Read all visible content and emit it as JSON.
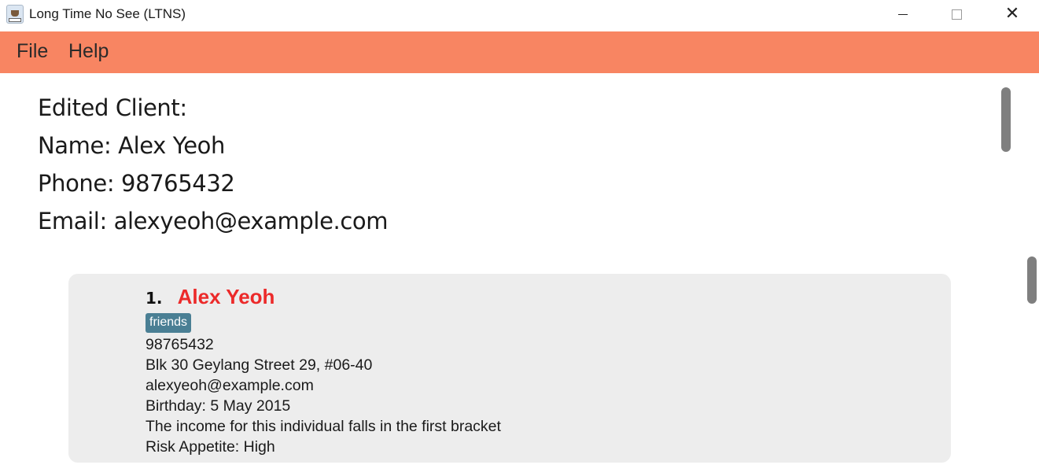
{
  "window": {
    "title": "Long Time No See (LTNS)",
    "icon": "app-icon",
    "controls": [
      "minimize",
      "maximize",
      "close"
    ]
  },
  "menu": {
    "items": [
      {
        "label": "File"
      },
      {
        "label": "Help"
      }
    ],
    "color": "#f88562"
  },
  "result": {
    "heading": "Edited Client:",
    "name_line": "Name: Alex Yeoh",
    "phone_line": "Phone: 98765432",
    "email_line": "Email: alexyeoh@example.com"
  },
  "client_card": {
    "index": "1.",
    "name": "Alex Yeoh",
    "name_color": "#ec2a2a",
    "tags": [
      "friends"
    ],
    "tag_color": "#4a7f94",
    "phone": "98765432",
    "address": "Blk 30 Geylang Street 29, #06-40",
    "email": "alexyeoh@example.com",
    "birthday": "Birthday: 5 May 2015",
    "income": "The income for this individual falls in the first bracket",
    "risk": "Risk Appetite: High"
  }
}
